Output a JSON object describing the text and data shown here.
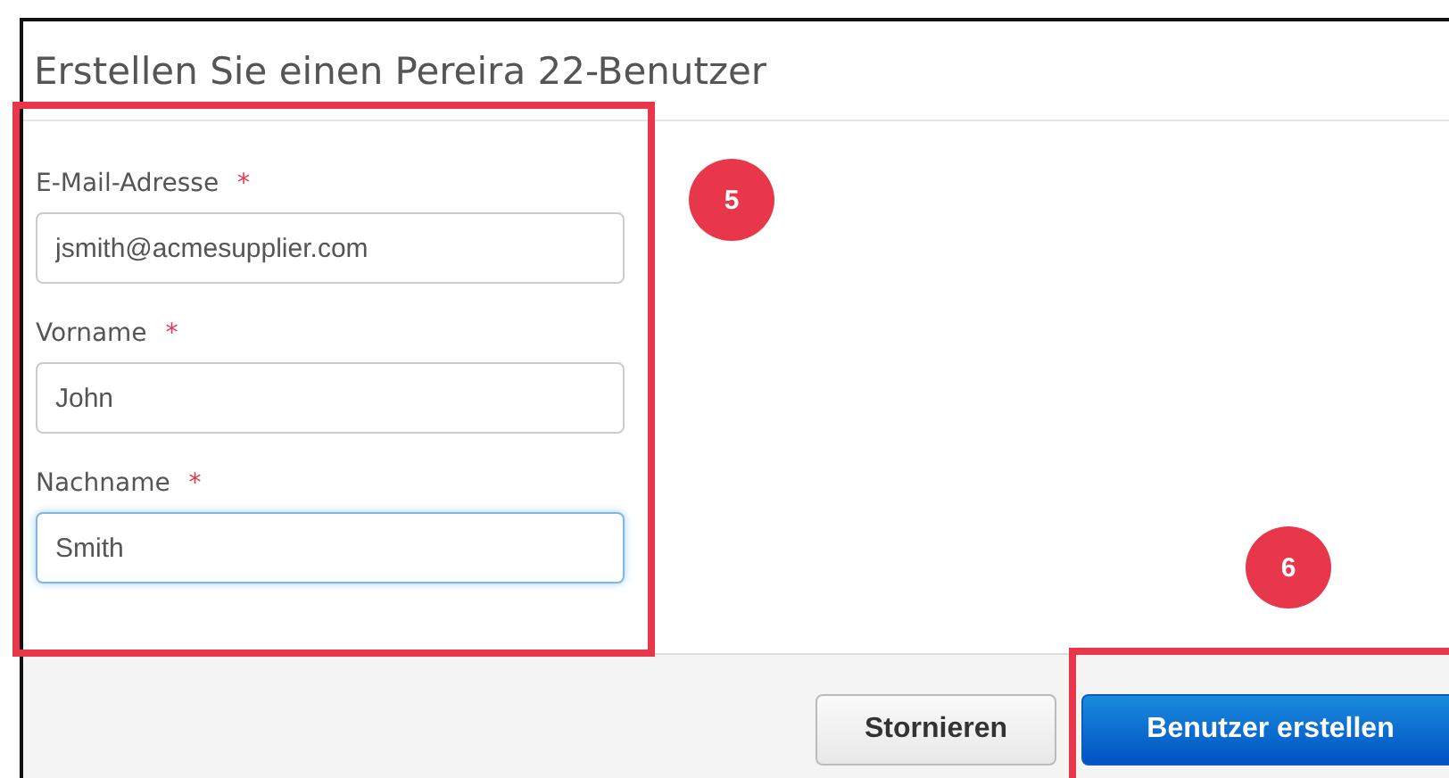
{
  "dialog": {
    "title": "Erstellen Sie einen Pereira 22-Benutzer"
  },
  "fields": [
    {
      "label": "E-Mail-Adresse",
      "required_mark": "*",
      "value": "jsmith@acmesupplier.com",
      "focused": false
    },
    {
      "label": "Vorname",
      "required_mark": "*",
      "value": "John",
      "focused": false
    },
    {
      "label": "Nachname",
      "required_mark": "*",
      "value": "Smith",
      "focused": true
    }
  ],
  "buttons": [
    {
      "label": "Stornieren",
      "kind": "secondary"
    },
    {
      "label": "Benutzer erstellen",
      "kind": "primary"
    }
  ],
  "callouts": [
    {
      "number": "5"
    },
    {
      "number": "6"
    }
  ]
}
